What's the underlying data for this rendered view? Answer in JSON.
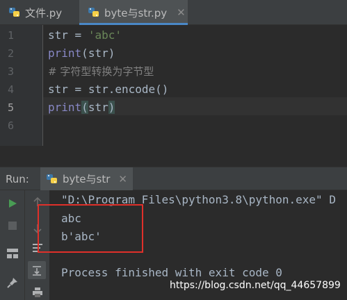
{
  "tabs": [
    {
      "label": "文件.py",
      "active": false
    },
    {
      "label": "byte与str.py",
      "active": true
    }
  ],
  "editor": {
    "line_numbers": [
      "1",
      "2",
      "3",
      "4",
      "5",
      "6"
    ],
    "current_line": "5",
    "lines": {
      "l1": {
        "var": "str",
        "op": " = ",
        "str": "'abc'"
      },
      "l2": {
        "fn": "print",
        "open": "(",
        "arg": "str",
        "close": ")"
      },
      "l3": {
        "comment": "# 字符型转换为字节型"
      },
      "l4": {
        "var": "str",
        "op": " = ",
        "expr": "str.encode()"
      },
      "l5": {
        "fn": "print",
        "open": "(",
        "arg": "str",
        "close": ")"
      }
    }
  },
  "run_panel": {
    "label": "Run:",
    "tab_label": "byte与str"
  },
  "console": {
    "command": "\"D:\\Program Files\\python3.8\\python.exe\" D",
    "output": [
      "abc",
      "b'abc'"
    ],
    "exit_message": "Process finished with exit code 0"
  },
  "watermark": "https://blog.csdn.net/qq_44657899",
  "colors": {
    "highlight_box": "#e0302a",
    "run_button": "#499c54",
    "python_blue": "#3c78aa",
    "python_yellow": "#f6d047"
  },
  "icons": [
    "python-file-icon",
    "close-icon",
    "run-icon",
    "stop-icon",
    "layout-icon",
    "pin-icon",
    "scroll-end-icon",
    "print-icon",
    "up-arrow-icon",
    "down-arrow-icon",
    "soft-wrap-icon"
  ]
}
